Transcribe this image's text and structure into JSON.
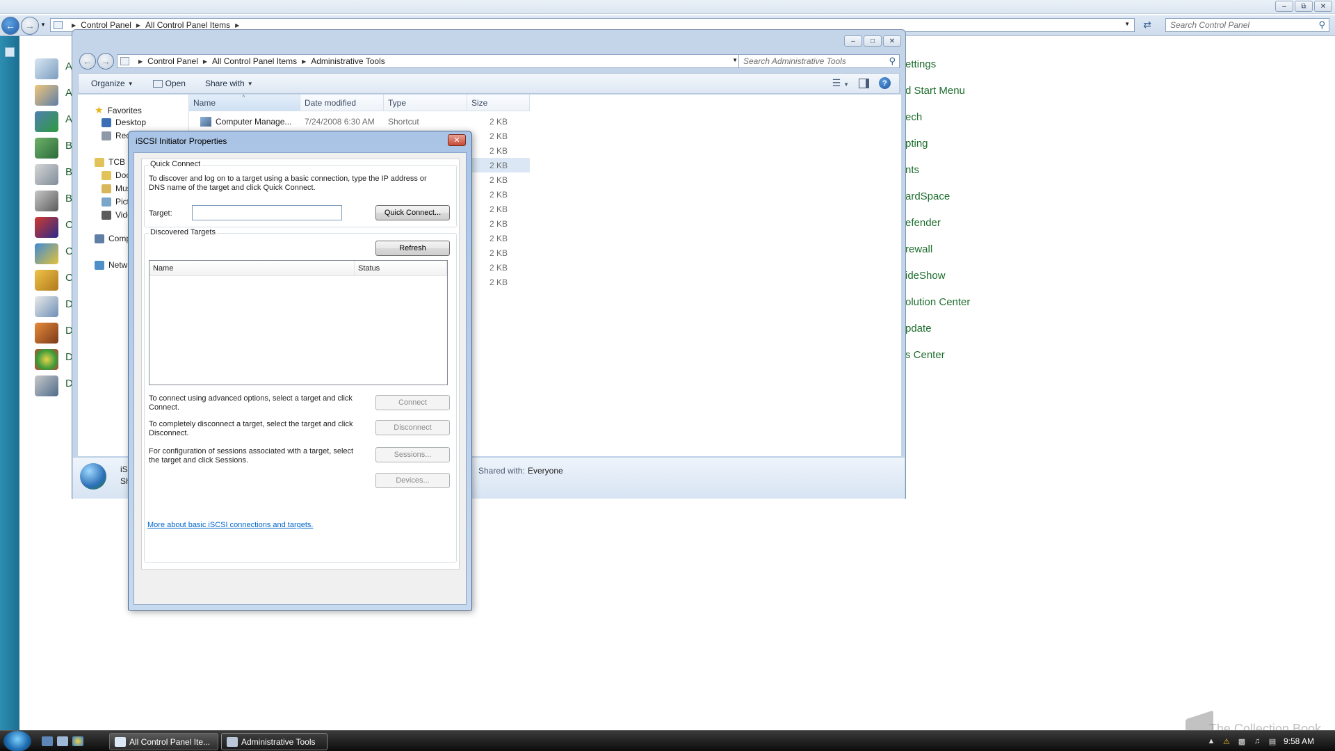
{
  "control_panel": {
    "breadcrumb": [
      "Control Panel",
      "All Control Panel Items"
    ],
    "search_placeholder": "Search Control Panel",
    "item_stubs": [
      "A",
      "A",
      "A",
      "B",
      "B",
      "B",
      "C",
      "C",
      "C",
      "D",
      "D",
      "D",
      "D"
    ],
    "right_links": [
      "ettings",
      "d Start Menu",
      "ech",
      "pting",
      "nts",
      "ardSpace",
      "efender",
      "rewall",
      "ideShow",
      "olution Center",
      "pdate",
      "s Center"
    ],
    "window_controls": [
      "minimize",
      "restore",
      "close"
    ]
  },
  "explorer": {
    "breadcrumb": [
      "Control Panel",
      "All Control Panel Items",
      "Administrative Tools"
    ],
    "search_placeholder": "Search Administrative Tools",
    "toolbar": {
      "organize": "Organize",
      "open": "Open",
      "share_with": "Share with"
    },
    "nav": {
      "favorites": "Favorites",
      "desktop": "Desktop",
      "recent": "Rec",
      "tcb": "TCB",
      "documents": "Doc",
      "music": "Mus",
      "pictures": "Pict",
      "videos": "Vide",
      "computer": "Comp",
      "network": "Netw"
    },
    "columns": [
      "Name",
      "Date modified",
      "Type",
      "Size"
    ],
    "first_row": {
      "name": "Computer Manage...",
      "date": "7/24/2008 6:30 AM",
      "type": "Shortcut",
      "size": "2 KB"
    },
    "sizes": [
      "2 KB",
      "2 KB",
      "2 KB",
      "2 KB",
      "2 KB",
      "2 KB",
      "2 KB",
      "2 KB",
      "2 KB",
      "2 KB",
      "2 KB"
    ],
    "details": {
      "name_stub": "iS",
      "type_stub": "Sh",
      "shared_label": "Shared with:",
      "shared_value": "Everyone"
    }
  },
  "dialog": {
    "title": "iSCSI Initiator Properties",
    "quick_connect": {
      "group_label": "Quick Connect",
      "description": "To discover and log on to a target using a basic connection, type the IP address or DNS name of the target and click Quick Connect.",
      "target_label": "Target:",
      "target_value": "",
      "button": "Quick Connect..."
    },
    "discovered": {
      "group_label": "Discovered Targets",
      "refresh": "Refresh",
      "columns": [
        "Name",
        "Status"
      ],
      "connect_text": "To connect using advanced options, select a target and click Connect.",
      "connect_button": "Connect",
      "disconnect_text": "To completely disconnect a target, select the target and click Disconnect.",
      "disconnect_button": "Disconnect",
      "sessions_text": "For configuration of sessions associated with a target, select the target and click Sessions.",
      "sessions_button": "Sessions...",
      "devices_button": "Devices..."
    },
    "more_link": "More about basic iSCSI connections and targets."
  },
  "taskbar": {
    "tasks": [
      {
        "label": "All Control Panel Ite...",
        "active": false
      },
      {
        "label": "Administrative Tools",
        "active": true
      }
    ],
    "clock": "9:58 AM",
    "watermark": "The Collection Book"
  },
  "colors": {
    "link_green": "#1e6e2e",
    "dialog_link": "#0066cc",
    "frame_blue": "#c4d5ea"
  }
}
